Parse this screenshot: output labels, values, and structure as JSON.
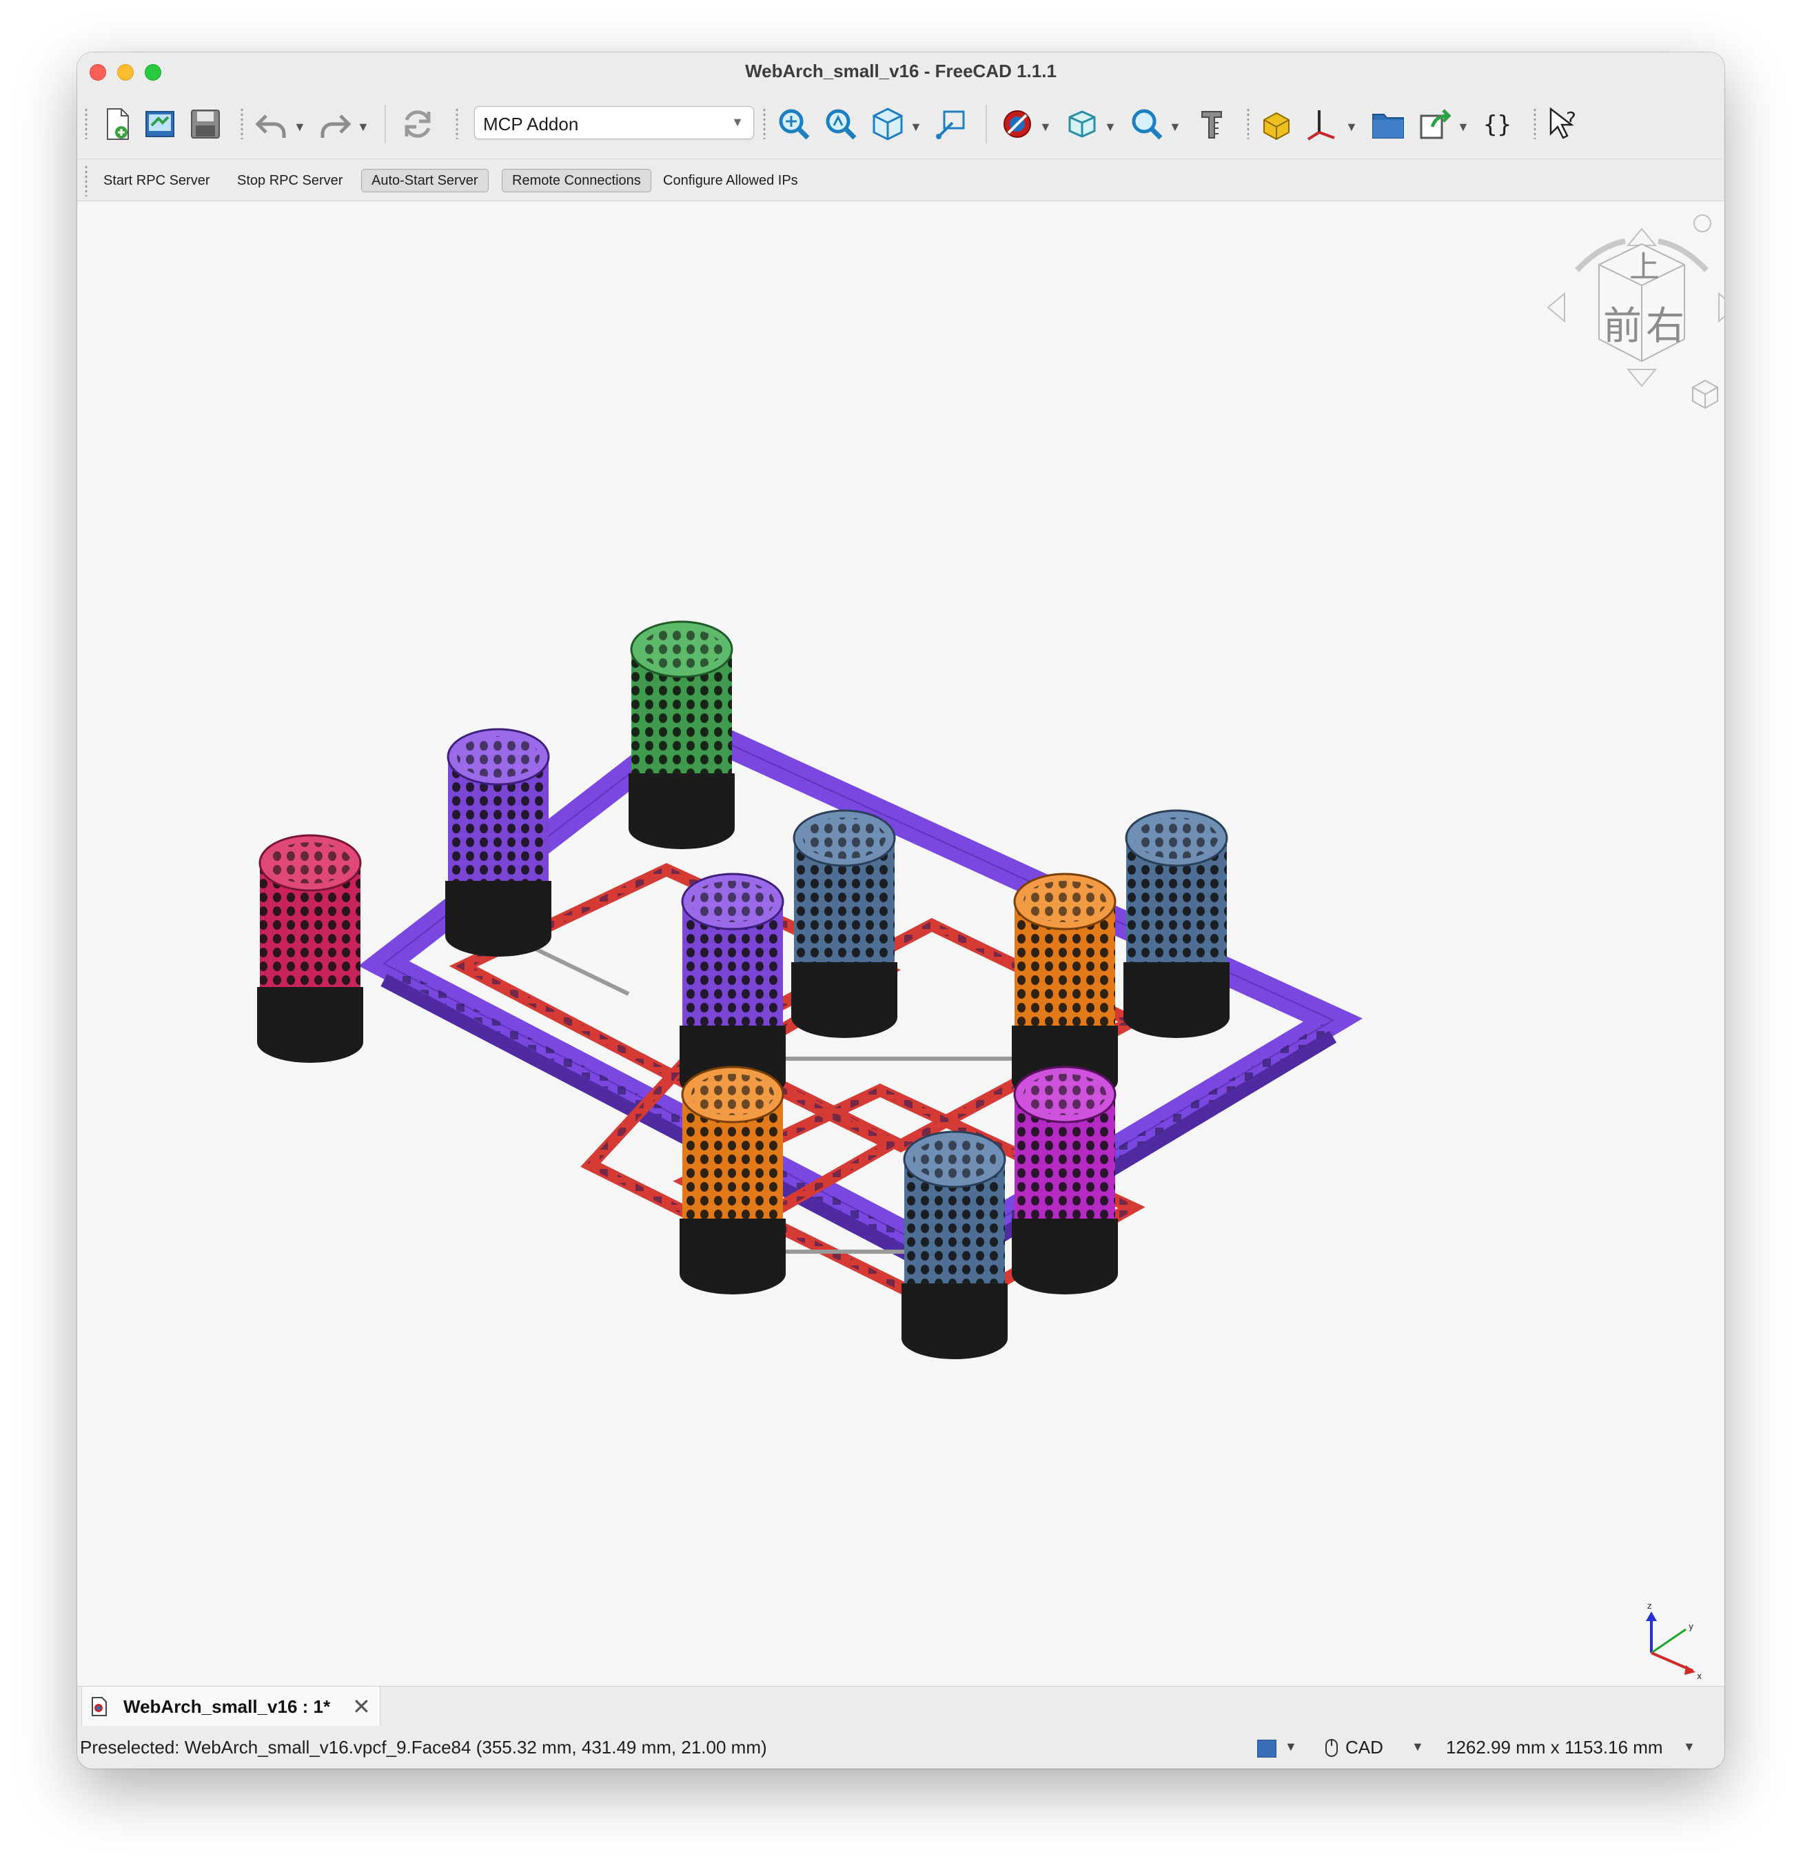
{
  "window": {
    "title": "WebArch_small_v16 - FreeCAD 1.1.1"
  },
  "toolbar": {
    "workbench_selected": "MCP Addon",
    "icons": [
      "new-document-icon",
      "open-document-icon",
      "save-icon",
      "undo-icon",
      "redo-icon",
      "refresh-icon",
      "fit-all-icon",
      "fit-selection-icon",
      "standard-views-icon",
      "bounding-box-icon",
      "draw-style-icon",
      "stereo-icon",
      "zoom-icon",
      "measure-icon",
      "part-icon",
      "std-axis-icon",
      "group-folder-icon",
      "link-icon",
      "macro-icon",
      "whats-this-icon"
    ]
  },
  "mcp_toolbar": {
    "start_rpc": "Start RPC Server",
    "stop_rpc": "Stop RPC Server",
    "auto_start": "Auto-Start Server",
    "remote_connections": "Remote Connections",
    "configure_ips": "Configure Allowed IPs"
  },
  "navcube": {
    "top": "上",
    "front": "前",
    "right": "右"
  },
  "axis": {
    "x": "x",
    "y": "y",
    "z": "z"
  },
  "tab": {
    "label": "WebArch_small_v16 : 1*",
    "close": "✕"
  },
  "status": {
    "message": "Preselected: WebArch_small_v16.vpcf_9.Face84 (355.32 mm, 431.49 mm, 21.00 mm)",
    "nav_style": "CAD",
    "dimensions": "1262.99 mm x 1153.16 mm"
  },
  "colors": {
    "frame": "#7a48e0",
    "inner_frame": "#d63a34",
    "pot_crimson": "#c8245a",
    "pot_purple": "#7b45d6",
    "pot_green": "#3f9a4d",
    "pot_slate": "#4e6f93",
    "pot_orange": "#e27a1a",
    "pot_magenta": "#b62ac4"
  }
}
